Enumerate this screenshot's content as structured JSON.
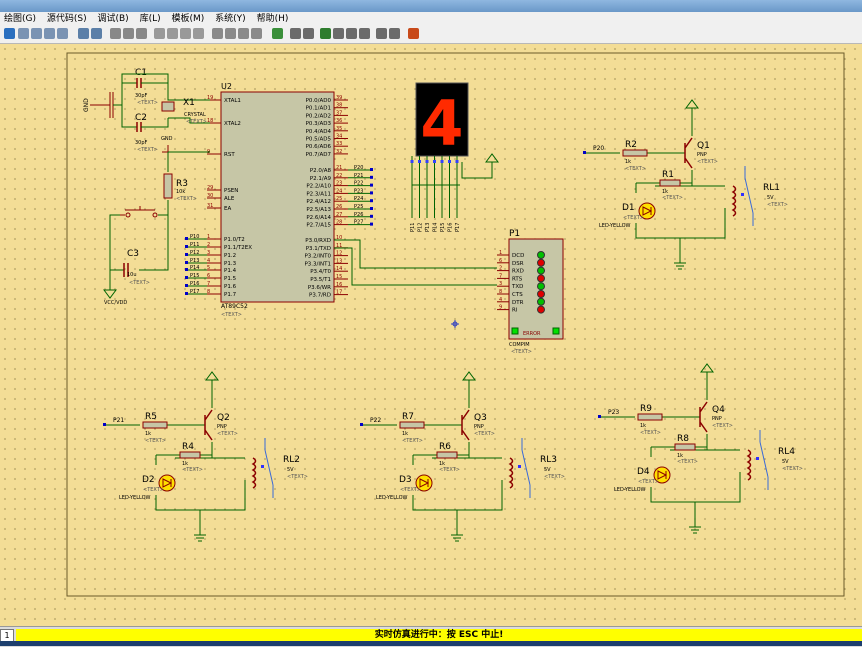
{
  "menu": [
    "绘图(G)",
    "源代码(S)",
    "调试(B)",
    "库(L)",
    "模板(M)",
    "系统(Y)",
    "帮助(H)"
  ],
  "status": {
    "number": "1",
    "message": "实时仿真进行中：按 ESC 中止!"
  },
  "colors": {
    "background": "#f3dd96",
    "wire": "#006400",
    "chip_fill": "#c6c6a6",
    "component": "#8b0000",
    "led_on": "#ff2a00"
  },
  "display": {
    "digit": "4"
  },
  "mcu": {
    "ref": "U2",
    "part": "AT89C52",
    "text": "<TEXT>",
    "left_pins": [
      {
        "num": "19",
        "name": "XTAL1"
      },
      {
        "num": "18",
        "name": "XTAL2"
      },
      {
        "num": "9",
        "name": "RST"
      },
      {
        "num": "29",
        "name": "PSEN"
      },
      {
        "num": "30",
        "name": "ALE"
      },
      {
        "num": "31",
        "name": "EA"
      },
      {
        "num": "1",
        "name": "P1.0/T2"
      },
      {
        "num": "2",
        "name": "P1.1/T2EX"
      },
      {
        "num": "3",
        "name": "P1.2"
      },
      {
        "num": "4",
        "name": "P1.3"
      },
      {
        "num": "5",
        "name": "P1.4"
      },
      {
        "num": "6",
        "name": "P1.5"
      },
      {
        "num": "7",
        "name": "P1.6"
      },
      {
        "num": "8",
        "name": "P1.7"
      }
    ],
    "left_nets": [
      "P10",
      "P11",
      "P12",
      "P13",
      "P14",
      "P15",
      "P16",
      "P17"
    ],
    "right_pins": [
      {
        "num": "39",
        "name": "P0.0/AD0"
      },
      {
        "num": "38",
        "name": "P0.1/AD1"
      },
      {
        "num": "37",
        "name": "P0.2/AD2"
      },
      {
        "num": "36",
        "name": "P0.3/AD3"
      },
      {
        "num": "35",
        "name": "P0.4/AD4"
      },
      {
        "num": "34",
        "name": "P0.5/AD5"
      },
      {
        "num": "33",
        "name": "P0.6/AD6"
      },
      {
        "num": "32",
        "name": "P0.7/AD7"
      },
      {
        "num": "21",
        "name": "P2.0/A8"
      },
      {
        "num": "22",
        "name": "P2.1/A9"
      },
      {
        "num": "23",
        "name": "P2.2/A10"
      },
      {
        "num": "24",
        "name": "P2.3/A11"
      },
      {
        "num": "25",
        "name": "P2.4/A12"
      },
      {
        "num": "26",
        "name": "P2.5/A13"
      },
      {
        "num": "27",
        "name": "P2.6/A14"
      },
      {
        "num": "28",
        "name": "P2.7/A15"
      },
      {
        "num": "10",
        "name": "P3.0/RXD"
      },
      {
        "num": "11",
        "name": "P3.1/TXD"
      },
      {
        "num": "12",
        "name": "P3.2/INT0"
      },
      {
        "num": "13",
        "name": "P3.3/INT1"
      },
      {
        "num": "14",
        "name": "P3.4/T0"
      },
      {
        "num": "15",
        "name": "P3.5/T1"
      },
      {
        "num": "16",
        "name": "P3.6/WR"
      },
      {
        "num": "17",
        "name": "P3.7/RD"
      }
    ],
    "p2_nets": [
      "P20",
      "P21",
      "P22",
      "P23",
      "P24",
      "P25",
      "P26",
      "P27"
    ]
  },
  "osc": {
    "c1": {
      "ref": "C1",
      "value": "30pF",
      "text": "<TEXT>"
    },
    "c2": {
      "ref": "C2",
      "value": "30pF",
      "text": "<TEXT>"
    },
    "x1": {
      "ref": "X1",
      "value": "CRYSTAL",
      "text": "<TEXT>"
    },
    "gnd": "GND",
    "gnd2": "GND"
  },
  "reset": {
    "r3": {
      "ref": "R3",
      "value": "10k",
      "text": "<TEXT>"
    },
    "c3": {
      "ref": "C3",
      "value": "10u",
      "text": "<TEXT>"
    },
    "vcc": "VCC/VDD"
  },
  "display_nets": [
    "P11",
    "P12",
    "P13",
    "P14",
    "P15",
    "P16",
    "P17"
  ],
  "com": {
    "ref": "P1",
    "part": "COMPIM",
    "text": "<TEXT>",
    "error": "ERROR",
    "pins": [
      {
        "num": "1",
        "name": "DCD"
      },
      {
        "num": "6",
        "name": "DSR"
      },
      {
        "num": "2",
        "name": "RXD"
      },
      {
        "num": "7",
        "name": "RTS"
      },
      {
        "num": "3",
        "name": "TXD"
      },
      {
        "num": "8",
        "name": "CTS"
      },
      {
        "num": "4",
        "name": "DTR"
      },
      {
        "num": "9",
        "name": "RI"
      }
    ]
  },
  "drivers": [
    {
      "net": "P20",
      "rb": "R2",
      "rbv": "1k",
      "q": "Q1",
      "qt": "PNP",
      "rl": "R1",
      "rlv": "1k",
      "led": "D1",
      "ledt": "LED-YELLOW",
      "relay": "RL1",
      "relayv": "5V",
      "text": "<TEXT>"
    },
    {
      "net": "P21",
      "rb": "R5",
      "rbv": "1k",
      "q": "Q2",
      "qt": "PNP",
      "rl": "R4",
      "rlv": "1k",
      "led": "D2",
      "ledt": "LED-YELLOW",
      "relay": "RL2",
      "relayv": "5V",
      "text": "<TEXT>"
    },
    {
      "net": "P22",
      "rb": "R7",
      "rbv": "1k",
      "q": "Q3",
      "qt": "PNP",
      "rl": "R6",
      "rlv": "1k",
      "led": "D3",
      "ledt": "LED-YELLOW",
      "relay": "RL3",
      "relayv": "5V",
      "text": "<TEXT>"
    },
    {
      "net": "P23",
      "rb": "R9",
      "rbv": "1k",
      "q": "Q4",
      "qt": "PNP",
      "rl": "R8",
      "rlv": "1k",
      "led": "D4",
      "ledt": "LED-YELLOW",
      "relay": "RL4",
      "relayv": "5V",
      "text": "<TEXT>"
    }
  ]
}
